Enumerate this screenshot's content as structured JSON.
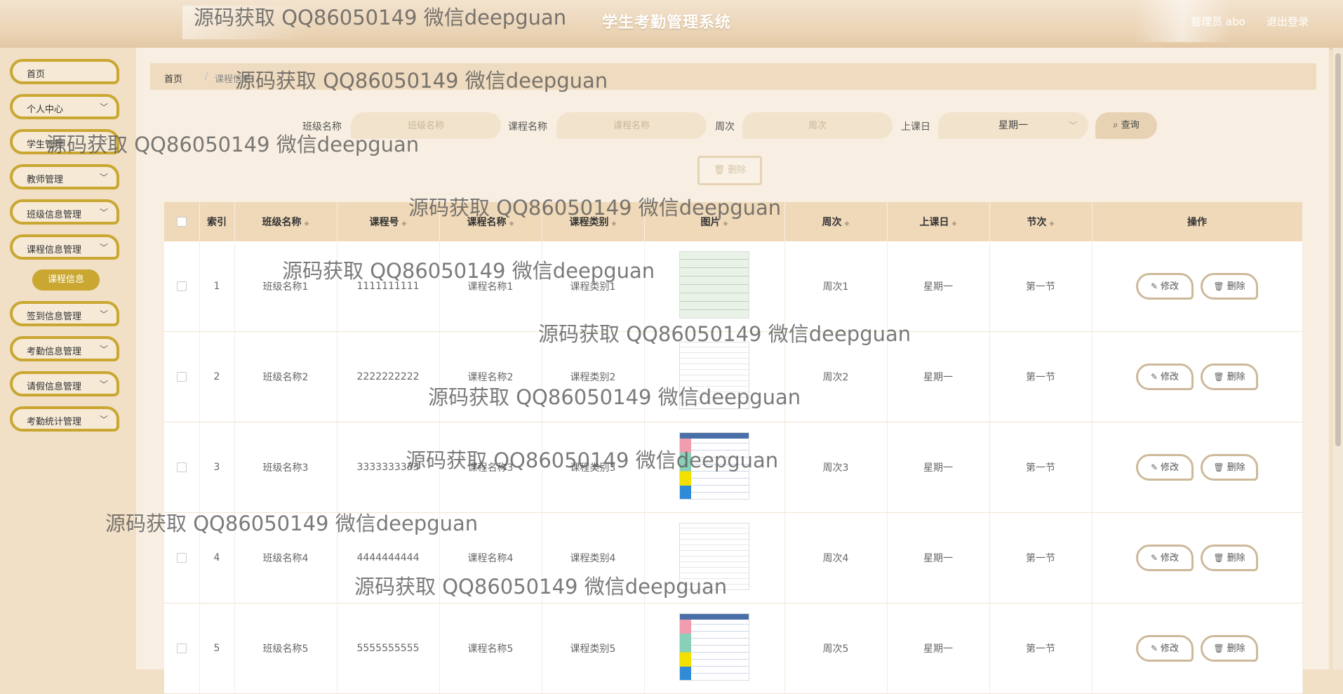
{
  "header": {
    "title": "学生考勤管理系统",
    "user": "管理员 abo",
    "logout": "退出登录"
  },
  "sidebar": {
    "items": [
      {
        "label": "首页",
        "chevron": ""
      },
      {
        "label": "个人中心",
        "chevron": "﹀"
      },
      {
        "label": "学生管理",
        "chevron": "﹀"
      },
      {
        "label": "教师管理",
        "chevron": "﹀"
      },
      {
        "label": "班级信息管理",
        "chevron": "﹀"
      },
      {
        "label": "课程信息管理",
        "chevron": "﹀"
      },
      {
        "label": "签到信息管理",
        "chevron": "﹀"
      },
      {
        "label": "考勤信息管理",
        "chevron": "﹀"
      },
      {
        "label": "请假信息管理",
        "chevron": "﹀"
      },
      {
        "label": "考勤统计管理",
        "chevron": "﹀"
      }
    ],
    "active_sub": "课程信息"
  },
  "breadcrumb": {
    "home": "首页",
    "sep": "/",
    "current": "课程信息"
  },
  "search": {
    "class_label": "班级名称",
    "class_placeholder": "班级名称",
    "course_label": "课程名称",
    "course_placeholder": "课程名称",
    "week_label": "周次",
    "week_placeholder": "周次",
    "day_label": "上课日",
    "day_value": "星期一",
    "query": "查询",
    "query_icon": "search-icon"
  },
  "batch_delete": "删除",
  "table": {
    "headers": [
      "索引",
      "班级名称",
      "课程号",
      "课程名称",
      "课程类别",
      "图片",
      "周次",
      "上课日",
      "节次",
      "操作"
    ],
    "rows": [
      {
        "index": "1",
        "class": "班级名称1",
        "course_no": "1111111111",
        "course": "课程名称1",
        "type": "课程类别1",
        "img": "green",
        "week": "周次1",
        "day": "星期一",
        "period": "第一节"
      },
      {
        "index": "2",
        "class": "班级名称2",
        "course_no": "2222222222",
        "course": "课程名称2",
        "type": "课程类别2",
        "img": "plain",
        "week": "周次2",
        "day": "星期一",
        "period": "第一节"
      },
      {
        "index": "3",
        "class": "班级名称3",
        "course_no": "3333333333",
        "course": "课程名称3",
        "type": "课程类别3",
        "img": "color",
        "week": "周次3",
        "day": "星期一",
        "period": "第一节"
      },
      {
        "index": "4",
        "class": "班级名称4",
        "course_no": "4444444444",
        "course": "课程名称4",
        "type": "课程类别4",
        "img": "plain",
        "week": "周次4",
        "day": "星期一",
        "period": "第一节"
      },
      {
        "index": "5",
        "class": "班级名称5",
        "course_no": "5555555555",
        "course": "课程名称5",
        "type": "课程类别5",
        "img": "color",
        "week": "周次5",
        "day": "星期一",
        "period": "第一节"
      }
    ],
    "edit": "修改",
    "delete": "删除"
  },
  "watermark": "源码获取 QQ86050149 微信deepguan",
  "colors": {
    "accent": "#c9a731",
    "header_bg": "#efd9b9",
    "page_bg": "#f8efe2"
  }
}
